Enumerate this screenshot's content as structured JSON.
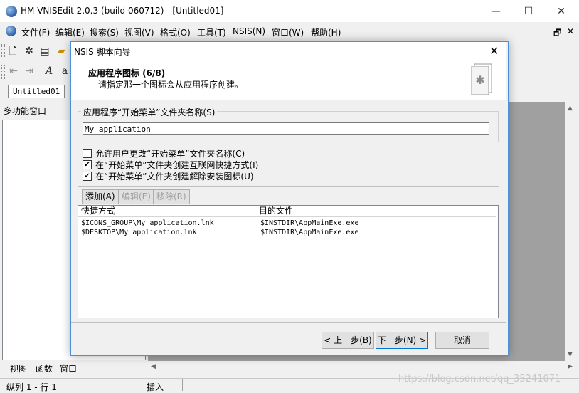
{
  "app": {
    "title": "HM VNISEdit 2.0.3 (build 060712) - [Untitled01]",
    "minimize": "—",
    "maximize": "☐",
    "close": "✕"
  },
  "menu": {
    "items": [
      "文件(F)",
      "编辑(E)",
      "搜索(S)",
      "视图(V)",
      "格式(O)",
      "工具(T)",
      "NSIS(N)",
      "窗口(W)",
      "帮助(H)"
    ],
    "mdi": [
      "_",
      "🗗",
      "✕"
    ]
  },
  "doc_tab": "Untitled01",
  "left_panel": {
    "title": "多功能窗口",
    "tabs": [
      "视图",
      "函数",
      "窗口"
    ]
  },
  "status": {
    "position": "纵列 1 - 行 1",
    "mode": "插入"
  },
  "watermark": "https://blog.csdn.net/qq_35241071",
  "dialog": {
    "title": "NSIS 脚本向导",
    "close": "✕",
    "header_title": "应用程序图标 (6/8)",
    "header_subtitle": "请指定那一个图标会从应用程序创建。",
    "group_label": "应用程序“开始菜单”文件夹名称(S)",
    "folder_name": "My application",
    "checkboxes": [
      {
        "label": "允许用户更改“开始菜单”文件夹名称(C)",
        "checked": false
      },
      {
        "label": "在“开始菜单”文件夹创建互联网快捷方式(I)",
        "checked": true
      },
      {
        "label": "在“开始菜单”文件夹创建解除安装图标(U)",
        "checked": true
      }
    ],
    "list_buttons": {
      "add": "添加(A)",
      "edit": "编辑(E)",
      "remove": "移除(R)"
    },
    "columns": [
      "快捷方式",
      "目的文件"
    ],
    "rows": [
      [
        "$ICONS_GROUP\\My application.lnk",
        "$INSTDIR\\AppMainExe.exe"
      ],
      [
        "$DESKTOP\\My application.lnk",
        "$INSTDIR\\AppMainExe.exe"
      ]
    ],
    "buttons": {
      "back": "< 上一步(B)",
      "next": "下一步(N) >",
      "cancel": "取消"
    }
  }
}
